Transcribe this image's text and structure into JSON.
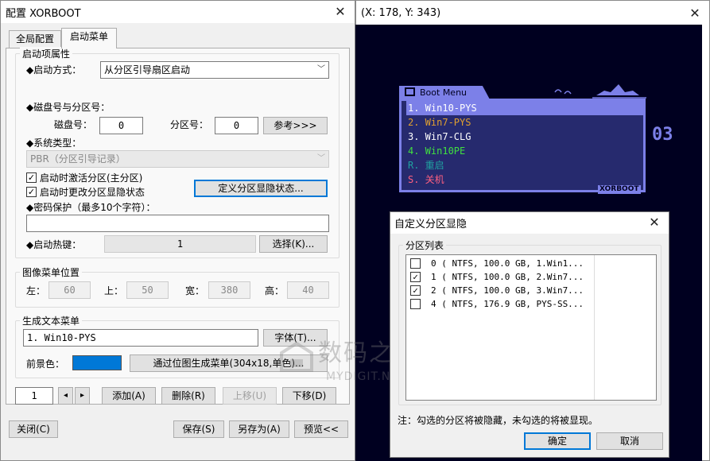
{
  "config_window": {
    "title": "配置 XORBOOT",
    "tabs": [
      "全局配置",
      "启动菜单"
    ],
    "active_tab": "启动菜单",
    "boot_props": {
      "group_label": "启动项属性",
      "boot_method_label": "◆启动方式：",
      "boot_method_value": "从分区引导扇区启动",
      "disk_part_label": "◆磁盘号与分区号：",
      "disk_label": "磁盘号：",
      "disk_value": "0",
      "part_label": "分区号：",
      "part_value": "0",
      "ref_button": "参考>>>",
      "sys_type_label": "◆系统类型：",
      "sys_type_value": "PBR（分区引导记录）",
      "activate_label": "启动时激活分区(主分区)",
      "activate_checked": true,
      "change_hide_label": "启动时更改分区显隐状态",
      "change_hide_checked": true,
      "define_button": "定义分区显隐状态...",
      "password_label": "◆密码保护（最多10个字符）：",
      "password_value": "",
      "hotkey_label": "◆启动热键：",
      "hotkey_value": "1",
      "select_button": "选择(K)..."
    },
    "image_menu": {
      "group_label": "图像菜单位置",
      "left_label": "左：",
      "left_value": "60",
      "top_label": "上：",
      "top_value": "50",
      "width_label": "宽：",
      "width_value": "380",
      "height_label": "高：",
      "height_value": "40"
    },
    "text_menu": {
      "group_label": "生成文本菜单",
      "text_value": "1. Win10-PYS",
      "font_button": "字体(T)...",
      "fg_label": "前景色：",
      "fg_color": "#0078d7",
      "bitmap_button": "通过位图生成菜单(304x18,单色)..."
    },
    "nav": {
      "index_value": "1",
      "left_arrow": "◂",
      "right_arrow": "▸",
      "add_button": "添加(A)",
      "delete_button": "删除(R)",
      "up_button": "上移(U)",
      "down_button": "下移(D)"
    },
    "footer": {
      "close_button": "关闭(C)",
      "save_button": "保存(S)",
      "saveas_button": "另存为(A)",
      "preview_button": "预览<<"
    }
  },
  "preview_window": {
    "coords": "(X: 178, Y: 343)",
    "boot_title": "Boot Menu",
    "brand": "XORBOOT",
    "countdown": "03",
    "items": [
      {
        "label": "1. Win10-PYS",
        "color": "#ffffff",
        "selected": true
      },
      {
        "label": "2. Win7-PYS",
        "color": "#e0a030",
        "selected": false
      },
      {
        "label": "3. Win7-CLG",
        "color": "#ffffff",
        "selected": false
      },
      {
        "label": "4. Win10PE",
        "color": "#40e040",
        "selected": false
      },
      {
        "label": "R. 重启",
        "color": "#20a0a0",
        "selected": false
      },
      {
        "label": "S. 关机",
        "color": "#ff6080",
        "selected": false
      }
    ],
    "colors": {
      "background": "#000020",
      "menu_bg": "#262a6e",
      "menu_border": "#7c80e8",
      "highlight": "#7c80e8"
    }
  },
  "partition_dialog": {
    "title": "自定义分区显隐",
    "group_label": "分区列表",
    "rows": [
      {
        "text": "0 ( NTFS, 100.0 GB, 1.Win1...",
        "checked": false
      },
      {
        "text": "1 ( NTFS, 100.0 GB, 2.Win7...",
        "checked": true
      },
      {
        "text": "2 ( NTFS, 100.0 GB, 3.Win7...",
        "checked": true
      },
      {
        "text": "4 ( NTFS, 176.9 GB, PYS-SS...",
        "checked": false
      }
    ],
    "note": "注：勾选的分区将被隐藏，未勾选的将被显现。",
    "ok_button": "确定",
    "cancel_button": "取消"
  },
  "watermark": {
    "cn": "数码之家",
    "en": "MYDIGIT.NET"
  }
}
